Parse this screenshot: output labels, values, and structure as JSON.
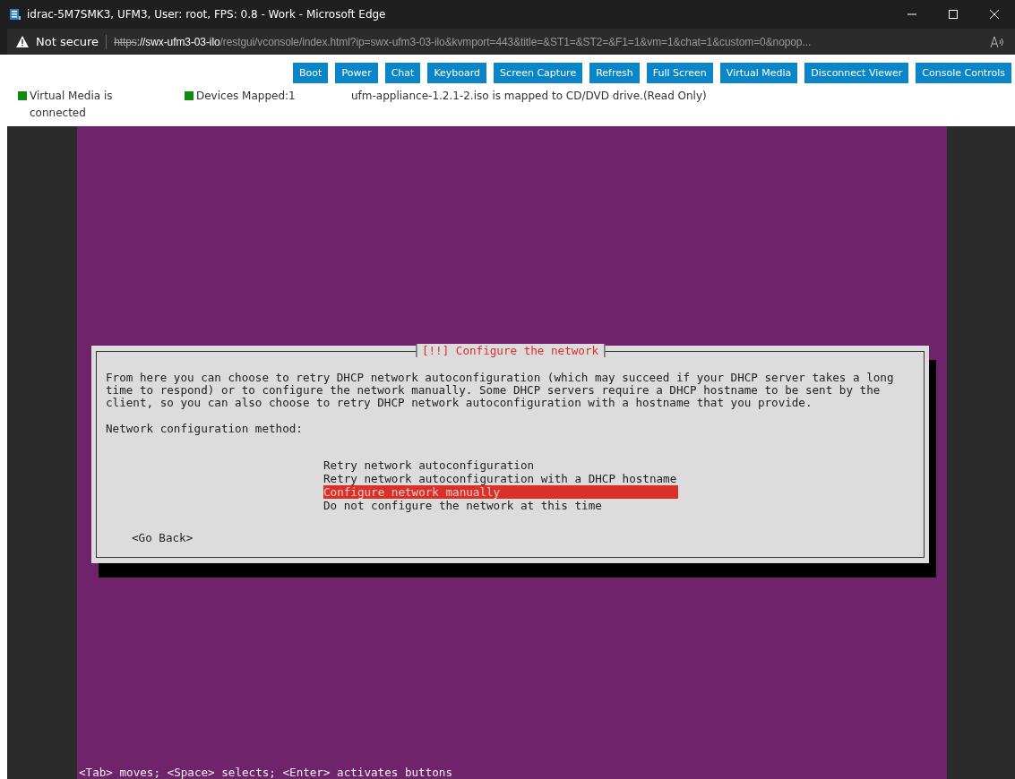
{
  "window": {
    "title": "idrac-5M7SMK3, UFM3, User: root, FPS: 0.8 - Work - Microsoft Edge"
  },
  "address_bar": {
    "security": "Not secure",
    "url_scheme": "https",
    "url_host": "://swx-ufm3-03-ilo",
    "url_path": "/restgui/vconsole/index.html?ip=swx-ufm3-03-ilo&kvmport=443&title=&ST1=&ST2=&F1=1&vm=1&chat=1&custom=0&nopop..."
  },
  "toolbar": {
    "buttons": [
      "Boot",
      "Power",
      "Chat",
      "Keyboard",
      "Screen Capture",
      "Refresh",
      "Full Screen",
      "Virtual Media",
      "Disconnect Viewer",
      "Console Controls"
    ]
  },
  "status": [
    {
      "text": "Virtual Media is connected",
      "color": "#108a10"
    },
    {
      "text": "Devices Mapped:1",
      "color": "#108a10"
    },
    {
      "text": "ufm-appliance-1.2.1-2.iso is mapped to CD/DVD drive.(Read Only)"
    }
  ],
  "dialog": {
    "title": "[!!] Configure the network",
    "description": "From here you can choose to retry DHCP network autoconfiguration (which may succeed if your DHCP server takes a long time to respond) or to configure the network manually. Some DHCP servers require a DHCP hostname to be sent by the client, so you can also choose to retry DHCP network autoconfiguration with a hostname that you provide.",
    "prompt": "Network configuration method:",
    "options": [
      {
        "label": "Retry network autoconfiguration",
        "selected": false
      },
      {
        "label": "Retry network autoconfiguration with a DHCP hostname",
        "selected": false
      },
      {
        "label": "Configure network manually",
        "selected": true
      },
      {
        "label": "Do not configure the network at this time",
        "selected": false
      }
    ],
    "back_button": "<Go Back>"
  },
  "footer": "<Tab> moves; <Space> selects; <Enter> activates buttons"
}
